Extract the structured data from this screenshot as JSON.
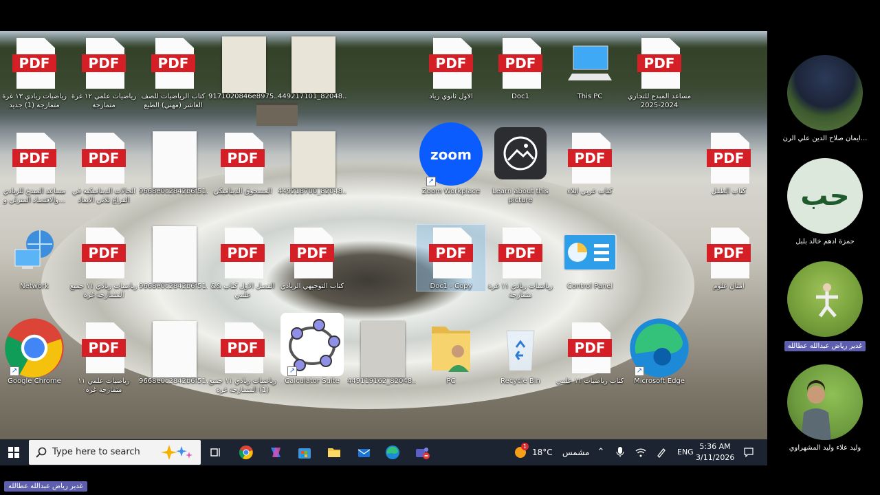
{
  "desktop": {
    "icons": [
      {
        "id": "i1",
        "type": "pdf",
        "label": "رياضيات ريادي ١٣ غرة متمازجة (1) جديد"
      },
      {
        "id": "i2",
        "type": "pdf",
        "label": "رياضيات علمي ١٢ غرة متمازجة"
      },
      {
        "id": "i3",
        "type": "pdf",
        "label": "كتاب الرياضيات للصف العاشر (مهني) الطبع"
      },
      {
        "id": "i4",
        "type": "thumb",
        "label": "9171020846e8975..."
      },
      {
        "id": "i5",
        "type": "thumb",
        "label": "449217101_82048..."
      },
      {
        "id": "i6",
        "type": "pdf",
        "label": "الاول ثانوي رياد"
      },
      {
        "id": "i7",
        "type": "pdf",
        "label": "Doc1"
      },
      {
        "id": "i8",
        "type": "thispc",
        "label": "This PC"
      },
      {
        "id": "i9",
        "type": "pdf",
        "label": "مساعد المبدع للتجاري 2024-2025"
      },
      {
        "id": "i10",
        "type": "pdf",
        "label": "مساعد المبدع للريادي والاقتصاد المنزلي و..."
      },
      {
        "id": "i11",
        "type": "pdf",
        "label": "الحالات الديناميكية في الفراغ ثلاثي الابعاد"
      },
      {
        "id": "i12",
        "type": "thumb-white",
        "label": "9668e0c2842b6f51..."
      },
      {
        "id": "i13",
        "type": "pdf",
        "label": "المسحوق الديناميكي"
      },
      {
        "id": "i14",
        "type": "thumb",
        "label": "449218700_82048..."
      },
      {
        "id": "i15",
        "type": "zoom",
        "label": "Zoom Workplace"
      },
      {
        "id": "i16",
        "type": "learn",
        "label": "Learn about this picture"
      },
      {
        "id": "i17",
        "type": "pdf",
        "label": "كتاب عربي ايلاء"
      },
      {
        "id": "i18",
        "type": "pdf",
        "label": "كتاب الطفل"
      },
      {
        "id": "i19",
        "type": "network",
        "label": "Network"
      },
      {
        "id": "i20",
        "type": "pdf",
        "label": "رياضيات ريادي ١١ جميع المتمازجة غرة"
      },
      {
        "id": "i21",
        "type": "thumb-white",
        "label": "9668e0c2842b6f51..."
      },
      {
        "id": "i22",
        "type": "pdf",
        "label": "الفصل الاول كتاب && علمي"
      },
      {
        "id": "i23",
        "type": "pdf",
        "label": "كتاب التوجيهي الريادي"
      },
      {
        "id": "i24",
        "type": "pdf",
        "label": "Doc1 - Copy"
      },
      {
        "id": "i25",
        "type": "pdf",
        "label": "رياضيات ريادي ١١ غرة متمازجة"
      },
      {
        "id": "i26",
        "type": "control",
        "label": "Control Panel"
      },
      {
        "id": "i27",
        "type": "pdf",
        "label": "امتان علوم"
      },
      {
        "id": "i28",
        "type": "chrome",
        "label": "Google Chrome"
      },
      {
        "id": "i29",
        "type": "pdf",
        "label": "رياضيات علمي ١١ متمازجة غرة"
      },
      {
        "id": "i30",
        "type": "thumb-white",
        "label": "9668e0c2842b6f51..."
      },
      {
        "id": "i31",
        "type": "pdf",
        "label": "رياضيات ريادي ١١ جميع (1) المتمازجة غرة"
      },
      {
        "id": "i32",
        "type": "geogebra",
        "label": "Calculator Suite"
      },
      {
        "id": "i33",
        "type": "thumb-gray",
        "label": "449119162_82048..."
      },
      {
        "id": "i34",
        "type": "folder",
        "label": "PC"
      },
      {
        "id": "i35",
        "type": "recycle",
        "label": "Recycle Bin"
      },
      {
        "id": "i36",
        "type": "pdf",
        "label": "كتاب رياضيات ١١ علمي"
      },
      {
        "id": "i37",
        "type": "edge",
        "label": "Microsoft Edge"
      }
    ],
    "pdf_badge": "PDF",
    "zoom_text": "zoom"
  },
  "taskbar": {
    "search_placeholder": "Type here to search",
    "weather_temp": "18°C",
    "weather_desc": "مشمس",
    "weather_badge": "1",
    "language": "ENG",
    "time": "5:36 AM",
    "date": "3/11/2026"
  },
  "participants": [
    {
      "name": "ايمان صلاح الدين علي الرن..."
    },
    {
      "name": "حمزة ادهم خالد بلبل",
      "initials": "حب"
    },
    {
      "name": "غدير رياض عبدالله عطالله"
    },
    {
      "name": "وليد علاء وليد المشهراوي"
    }
  ],
  "active_speaker": "غدير رياض عبدالله عطالله",
  "colors": {
    "pdf_red": "#d41f26",
    "taskbar": "#1d2431",
    "name_tag": "#5d5fae",
    "initials_bg": "#dde8dd",
    "initials_fg": "#1e5a2c"
  }
}
